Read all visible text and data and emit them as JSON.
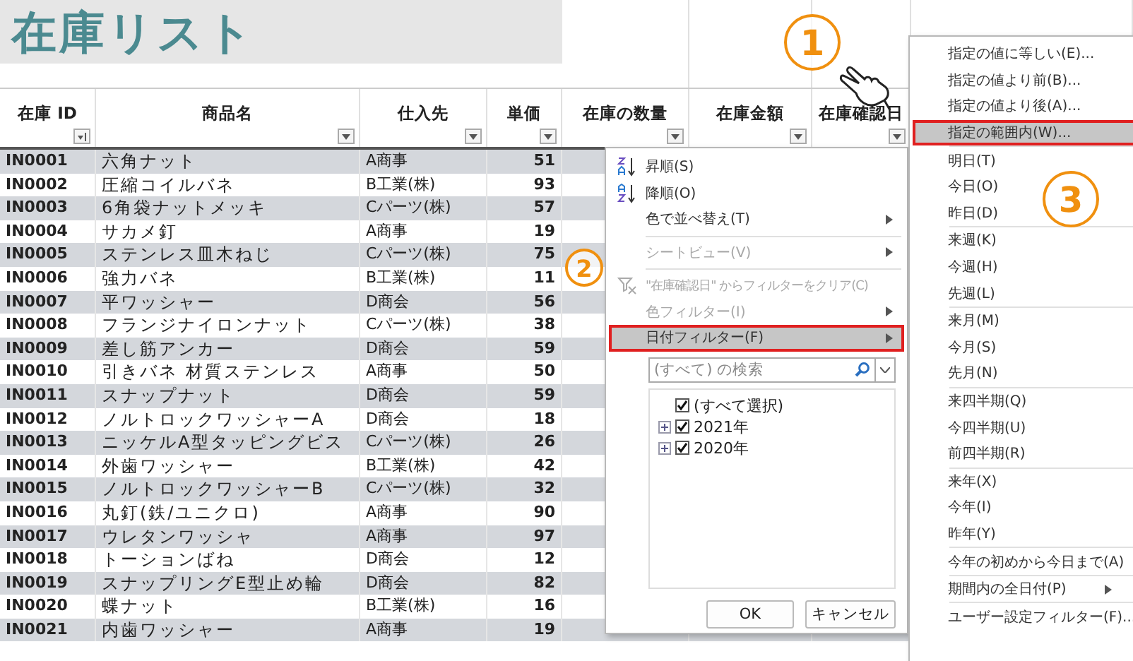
{
  "title": "在庫リスト",
  "columns": [
    {
      "label": "在庫 ID",
      "sorted": true
    },
    {
      "label": "商品名",
      "sorted": false
    },
    {
      "label": "仕入先",
      "sorted": false
    },
    {
      "label": "単価",
      "sorted": false
    },
    {
      "label": "在庫の数量",
      "sorted": false
    },
    {
      "label": "在庫金額",
      "sorted": false
    },
    {
      "label": "在庫確認日",
      "sorted": false
    }
  ],
  "rows": [
    {
      "id": "IN0001",
      "name": "六角ナット",
      "supplier": "A商事",
      "price": "51"
    },
    {
      "id": "IN0002",
      "name": "圧縮コイルバネ",
      "supplier": "B工業(株)",
      "price": "93"
    },
    {
      "id": "IN0003",
      "name": "6角袋ナットメッキ",
      "supplier": "Cパーツ(株)",
      "price": "57"
    },
    {
      "id": "IN0004",
      "name": "サカメ釘",
      "supplier": "A商事",
      "price": "19"
    },
    {
      "id": "IN0005",
      "name": "ステンレス皿木ねじ",
      "supplier": "Cパーツ(株)",
      "price": "75"
    },
    {
      "id": "IN0006",
      "name": "強力バネ",
      "supplier": "B工業(株)",
      "price": "11"
    },
    {
      "id": "IN0007",
      "name": "平ワッシャー",
      "supplier": "D商会",
      "price": "56"
    },
    {
      "id": "IN0008",
      "name": "フランジナイロンナット",
      "supplier": "Cパーツ(株)",
      "price": "38"
    },
    {
      "id": "IN0009",
      "name": "差し筋アンカー",
      "supplier": "D商会",
      "price": "59"
    },
    {
      "id": "IN0010",
      "name": "引きバネ 材質ステンレス",
      "supplier": "A商事",
      "price": "50"
    },
    {
      "id": "IN0011",
      "name": "スナップナット",
      "supplier": "D商会",
      "price": "59"
    },
    {
      "id": "IN0012",
      "name": "ノルトロックワッシャーA",
      "supplier": "D商会",
      "price": "18"
    },
    {
      "id": "IN0013",
      "name": "ニッケルA型タッピングビス",
      "supplier": "Cパーツ(株)",
      "price": "26"
    },
    {
      "id": "IN0014",
      "name": "外歯ワッシャー",
      "supplier": "B工業(株)",
      "price": "42"
    },
    {
      "id": "IN0015",
      "name": "ノルトロックワッシャーB",
      "supplier": "Cパーツ(株)",
      "price": "32"
    },
    {
      "id": "IN0016",
      "name": "丸釘(鉄/ユニクロ)",
      "supplier": "A商事",
      "price": "90"
    },
    {
      "id": "IN0017",
      "name": "ウレタンワッシャ",
      "supplier": "A商事",
      "price": "97"
    },
    {
      "id": "IN0018",
      "name": "トーションばね",
      "supplier": "D商会",
      "price": "12"
    },
    {
      "id": "IN0019",
      "name": "スナップリングE型止め輪",
      "supplier": "D商会",
      "price": "82"
    },
    {
      "id": "IN0020",
      "name": "蝶ナット",
      "supplier": "B工業(株)",
      "price": "16"
    },
    {
      "id": "IN0021",
      "name": "内歯ワッシャー",
      "supplier": "A商事",
      "price": "19"
    }
  ],
  "filter_menu": {
    "groups": [
      [
        {
          "label": "昇順(S)",
          "kind": "sort_asc",
          "disabled": false,
          "submenu": false,
          "selected": false
        },
        {
          "label": "降順(O)",
          "kind": "sort_desc",
          "disabled": false,
          "submenu": false,
          "selected": false
        },
        {
          "label": "色で並べ替え(T)",
          "kind": "plain",
          "disabled": false,
          "submenu": true,
          "selected": false
        }
      ],
      [
        {
          "label": "シートビュー(V)",
          "kind": "plain",
          "disabled": true,
          "submenu": true,
          "selected": false
        }
      ],
      [
        {
          "label": "\"在庫確認日\" からフィルターをクリア(C)",
          "kind": "clear_filter",
          "disabled": true,
          "submenu": false,
          "selected": false
        },
        {
          "label": "色フィルター(I)",
          "kind": "plain",
          "disabled": true,
          "submenu": true,
          "selected": false
        },
        {
          "label": "日付フィルター(F)",
          "kind": "plain",
          "disabled": false,
          "submenu": true,
          "selected": true
        }
      ]
    ],
    "search": {
      "placeholder": "(すべて) の検索"
    },
    "tree": [
      {
        "label": "(すべて選択)",
        "checked": true,
        "children": [
          {
            "label": "2021年",
            "checked": true
          },
          {
            "label": "2020年",
            "checked": true
          }
        ]
      }
    ],
    "buttons": [
      "OK",
      "キャンセル"
    ]
  },
  "date_menu": {
    "groups": [
      [
        {
          "label": "指定の値に等しい(E)...",
          "selected": false,
          "submenu": false
        },
        {
          "label": "指定の値より前(B)...",
          "selected": false,
          "submenu": false
        },
        {
          "label": "指定の値より後(A)...",
          "selected": false,
          "submenu": false
        },
        {
          "label": "指定の範囲内(W)...",
          "selected": true,
          "submenu": false
        }
      ],
      [
        {
          "label": "明日(T)",
          "selected": false,
          "submenu": false
        },
        {
          "label": "今日(O)",
          "selected": false,
          "submenu": false
        },
        {
          "label": "昨日(D)",
          "selected": false,
          "submenu": false
        }
      ],
      [
        {
          "label": "来週(K)",
          "selected": false,
          "submenu": false
        },
        {
          "label": "今週(H)",
          "selected": false,
          "submenu": false
        },
        {
          "label": "先週(L)",
          "selected": false,
          "submenu": false
        }
      ],
      [
        {
          "label": "来月(M)",
          "selected": false,
          "submenu": false
        },
        {
          "label": "今月(S)",
          "selected": false,
          "submenu": false
        },
        {
          "label": "先月(N)",
          "selected": false,
          "submenu": false
        }
      ],
      [
        {
          "label": "来四半期(Q)",
          "selected": false,
          "submenu": false
        },
        {
          "label": "今四半期(U)",
          "selected": false,
          "submenu": false
        },
        {
          "label": "前四半期(R)",
          "selected": false,
          "submenu": false
        }
      ],
      [
        {
          "label": "来年(X)",
          "selected": false,
          "submenu": false
        },
        {
          "label": "今年(I)",
          "selected": false,
          "submenu": false
        },
        {
          "label": "昨年(Y)",
          "selected": false,
          "submenu": false
        }
      ],
      [
        {
          "label": "今年の初めから今日まで(A)",
          "selected": false,
          "submenu": false
        }
      ],
      [
        {
          "label": "期間内の全日付(P)",
          "selected": false,
          "submenu": true
        }
      ],
      [
        {
          "label": "ユーザー設定フィルター(F)...",
          "selected": false,
          "submenu": false
        }
      ]
    ]
  },
  "step_markers": [
    "1",
    "2",
    "3"
  ]
}
